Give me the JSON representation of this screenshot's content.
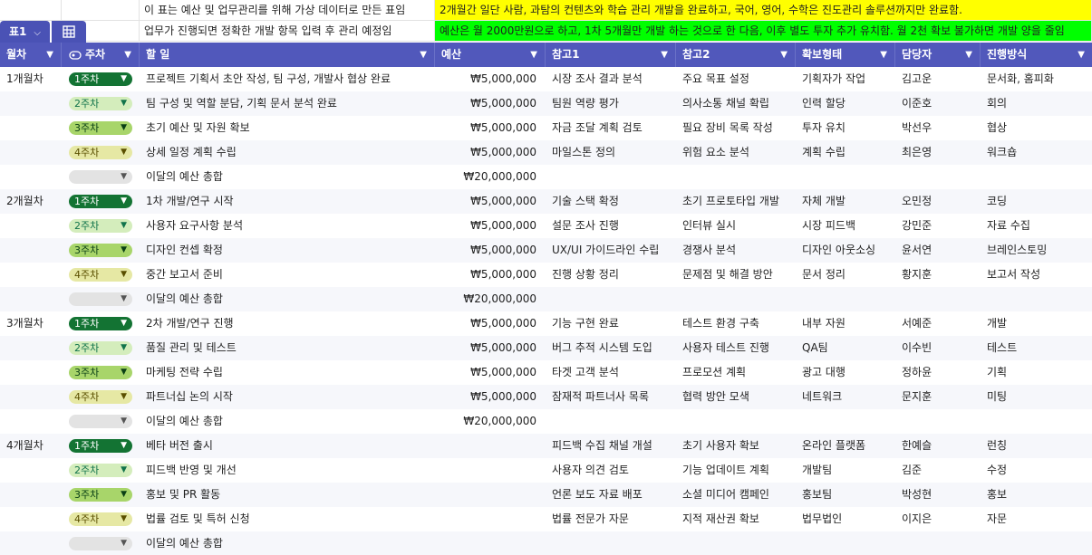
{
  "notes": {
    "row1_left": "이 표는 예산 및 업무관리를 위해 가상 데이터로 만든 표임",
    "row1_right": "2개월간 일단 사람, 과탐의 컨텐츠와 학습 관리 개발을 완료하고, 국어, 영어, 수학은 진도관리 솔루션까지만 완료함.",
    "row2_left": "업무가 진행되면 정확한 개발 항목 입력 후 관리 예정임",
    "row2_right": "예산은 월 2000만원으로 하고, 1차 5개월만 개발 하는 것으로 한 다음, 이후 별도 투자 추가 유치함. 월 2천 확보 불가하면 개발 양을 줄임"
  },
  "table_tab": {
    "label": "표1"
  },
  "colors": {
    "header": "#5158bb",
    "tab": "#4a52b5",
    "yellow": "#ffff00",
    "green": "#00ff00"
  },
  "columns": [
    "월차",
    "주차",
    "할 일",
    "예산",
    "참고1",
    "참고2",
    "확보형태",
    "담당자",
    "진행방식"
  ],
  "rows": [
    {
      "month": "1개월차",
      "week": "1주차",
      "task": "프로젝트 기획서 초안 작성, 팀 구성, 개발사 협상 완료",
      "budget": "₩5,000,000",
      "ref1": "시장 조사 결과 분석",
      "ref2": "주요 목표 설정",
      "type": "기획자가 작업",
      "owner": "김고운",
      "method": "문서화, 홈피화"
    },
    {
      "month": "",
      "week": "2주차",
      "task": "팀 구성 및 역할 분담, 기획 문서 분석 완료",
      "budget": "₩5,000,000",
      "ref1": "팀원 역량 평가",
      "ref2": "의사소통 채널 확립",
      "type": "인력 할당",
      "owner": "이준호",
      "method": "회의"
    },
    {
      "month": "",
      "week": "3주차",
      "task": "초기 예산 및 자원 확보",
      "budget": "₩5,000,000",
      "ref1": "자금 조달 계획 검토",
      "ref2": "필요 장비 목록 작성",
      "type": "투자 유치",
      "owner": "박선우",
      "method": "협상"
    },
    {
      "month": "",
      "week": "4주차",
      "task": "상세 일정 계획 수립",
      "budget": "₩5,000,000",
      "ref1": "마일스톤 정의",
      "ref2": "위험 요소 분석",
      "type": "계획 수립",
      "owner": "최은영",
      "method": "워크숍"
    },
    {
      "month": "",
      "week": "",
      "task": "이달의 예산 총합",
      "budget": "₩20,000,000",
      "ref1": "",
      "ref2": "",
      "type": "",
      "owner": "",
      "method": ""
    },
    {
      "month": "2개월차",
      "week": "1주차",
      "task": "1차 개발/연구 시작",
      "budget": "₩5,000,000",
      "ref1": "기술 스택 확정",
      "ref2": "초기 프로토타입 개발",
      "type": "자체 개발",
      "owner": "오민정",
      "method": "코딩"
    },
    {
      "month": "",
      "week": "2주차",
      "task": "사용자 요구사항 분석",
      "budget": "₩5,000,000",
      "ref1": "설문 조사 진행",
      "ref2": "인터뷰 실시",
      "type": "시장 피드백",
      "owner": "강민준",
      "method": "자료 수집"
    },
    {
      "month": "",
      "week": "3주차",
      "task": "디자인 컨셉 확정",
      "budget": "₩5,000,000",
      "ref1": "UX/UI 가이드라인 수립",
      "ref2": "경쟁사 분석",
      "type": "디자인 아웃소싱",
      "owner": "윤서연",
      "method": "브레인스토밍"
    },
    {
      "month": "",
      "week": "4주차",
      "task": "중간 보고서 준비",
      "budget": "₩5,000,000",
      "ref1": "진행 상황 정리",
      "ref2": "문제점 및 해결 방안",
      "type": "문서 정리",
      "owner": "황지훈",
      "method": "보고서 작성"
    },
    {
      "month": "",
      "week": "",
      "task": "이달의 예산 총합",
      "budget": "₩20,000,000",
      "ref1": "",
      "ref2": "",
      "type": "",
      "owner": "",
      "method": ""
    },
    {
      "month": "3개월차",
      "week": "1주차",
      "task": "2차 개발/연구 진행",
      "budget": "₩5,000,000",
      "ref1": "기능 구현 완료",
      "ref2": "테스트 환경 구축",
      "type": "내부 자원",
      "owner": "서예준",
      "method": "개발"
    },
    {
      "month": "",
      "week": "2주차",
      "task": "품질 관리 및 테스트",
      "budget": "₩5,000,000",
      "ref1": "버그 추적 시스템 도입",
      "ref2": "사용자 테스트 진행",
      "type": "QA팀",
      "owner": "이수빈",
      "method": "테스트"
    },
    {
      "month": "",
      "week": "3주차",
      "task": "마케팅 전략 수립",
      "budget": "₩5,000,000",
      "ref1": "타겟 고객 분석",
      "ref2": "프로모션 계획",
      "type": "광고 대행",
      "owner": "정하윤",
      "method": "기획"
    },
    {
      "month": "",
      "week": "4주차",
      "task": "파트너십 논의 시작",
      "budget": "₩5,000,000",
      "ref1": "잠재적 파트너사 목록",
      "ref2": "협력 방안 모색",
      "type": "네트워크",
      "owner": "문지훈",
      "method": "미팅"
    },
    {
      "month": "",
      "week": "",
      "task": "이달의 예산 총합",
      "budget": "₩20,000,000",
      "ref1": "",
      "ref2": "",
      "type": "",
      "owner": "",
      "method": ""
    },
    {
      "month": "4개월차",
      "week": "1주차",
      "task": "베타 버전 출시",
      "budget": "",
      "ref1": "피드백 수집 채널 개설",
      "ref2": "초기 사용자 확보",
      "type": "온라인 플랫폼",
      "owner": "한예슬",
      "method": "런칭"
    },
    {
      "month": "",
      "week": "2주차",
      "task": "피드백 반영 및 개선",
      "budget": "",
      "ref1": "사용자 의견 검토",
      "ref2": "기능 업데이트 계획",
      "type": "개발팀",
      "owner": "김준",
      "method": "수정"
    },
    {
      "month": "",
      "week": "3주차",
      "task": "홍보 및 PR 활동",
      "budget": "",
      "ref1": "언론 보도 자료 배포",
      "ref2": "소셜 미디어 캠페인",
      "type": "홍보팀",
      "owner": "박성현",
      "method": "홍보"
    },
    {
      "month": "",
      "week": "4주차",
      "task": "법률 검토 및 특허 신청",
      "budget": "",
      "ref1": "법률 전문가 자문",
      "ref2": "지적 재산권 확보",
      "type": "법무법인",
      "owner": "이지은",
      "method": "자문"
    },
    {
      "month": "",
      "week": "",
      "task": "이달의 예산 총합",
      "budget": "",
      "ref1": "",
      "ref2": "",
      "type": "",
      "owner": "",
      "method": ""
    }
  ]
}
